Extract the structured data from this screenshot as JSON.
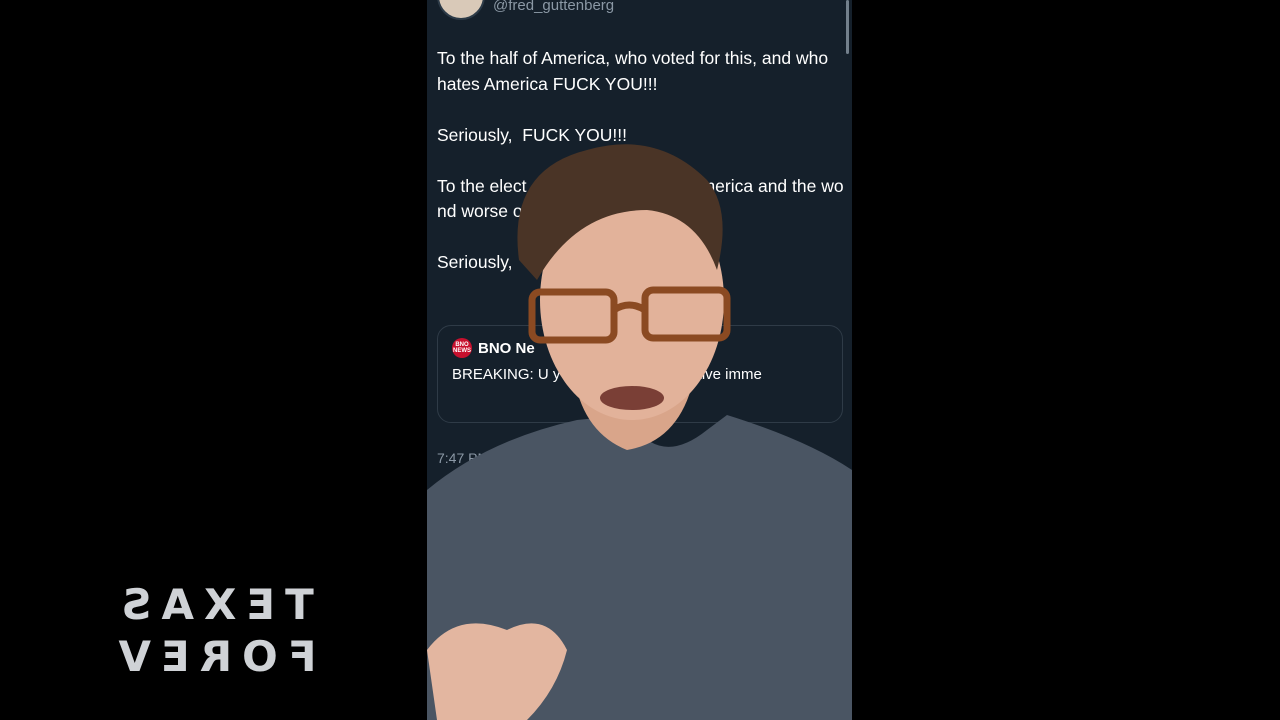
{
  "tweet": {
    "handle": "@fred_guttenberg",
    "paragraphs": [
      "To the half of America, who voted for this, and who hates America FUCK YOU!!!",
      "Seriously,  FUCK YOU!!!",
      "To the elect                  e making America and the wo                  nd worse off, FUCK YO",
      "Seriously,"
    ],
    "quote": {
      "source_name": "BNO Ne",
      "logo_text": "BNO NEWS",
      "text": "BREAKING: U                      y aid to Ukraine, effective imme"
    },
    "timestamp": "7:47 PM"
  },
  "shirt": {
    "line1": "TEXAS",
    "line2": "FOREV"
  },
  "colors": {
    "background": "#15202b",
    "text": "#ffffff",
    "muted": "#8b98a5",
    "border": "#2f3b47",
    "bno_red": "#c8102e",
    "shirt": "#4a5563"
  }
}
